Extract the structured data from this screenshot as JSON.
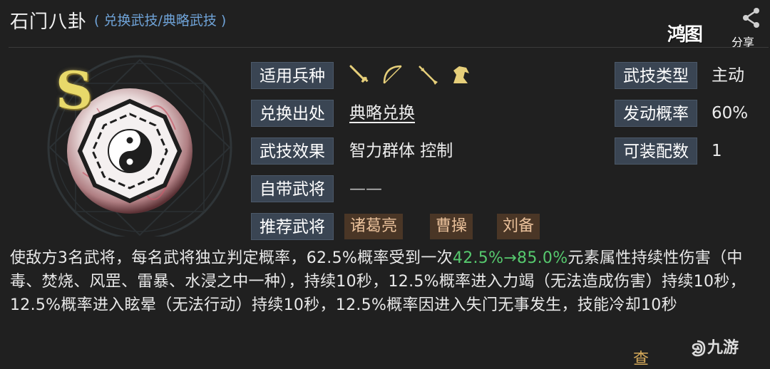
{
  "header": {
    "title": "石门八卦",
    "subtitle": "( 兑换武技/典略武技 )",
    "share_label": "分享",
    "brand_text": "鸿图"
  },
  "skill": {
    "grade": "S",
    "rows": [
      {
        "label": "适用兵种",
        "value": ""
      },
      {
        "label": "兑换出处",
        "value": "典略兑换"
      },
      {
        "label": "武技效果",
        "value": "智力群体 控制"
      },
      {
        "label": "自带武将",
        "value": "——"
      },
      {
        "label": "推荐武将",
        "value": ""
      }
    ],
    "weapons": [
      "sword-icon",
      "bow-icon",
      "spear-icon",
      "horse-icon"
    ],
    "recommended": [
      "诸葛亮",
      "曹操",
      "刘备"
    ],
    "right_rows": [
      {
        "label": "武技类型",
        "value": "主动"
      },
      {
        "label": "发动概率",
        "value": "60%"
      },
      {
        "label": "可装配数",
        "value": "1"
      }
    ]
  },
  "description": {
    "part1": "使敌方3名武将，每名武将独立判定概率，62.5%概率受到一次",
    "hl1": "42.5%",
    "arrow": "→",
    "hl2": "85.0%",
    "part2": "元素属性持续性伤害（中毒、焚烧、风罡、雷暴、水浸之中一种），持续10秒，12.5%概率进入力竭（无法造成伤害）持续10秒，12.5%概率进入眩晕（无法行动）持续10秒，12.5%概率因进入失门无事发生，技能冷却10秒"
  },
  "more_label": "查",
  "watermark": "九游",
  "colors": {
    "label_bg": "#3a4553",
    "chip_bg": "#4a3626",
    "highlight": "#56c96e",
    "subtitle": "#6fa3d8",
    "grade": "#e8d96a"
  }
}
